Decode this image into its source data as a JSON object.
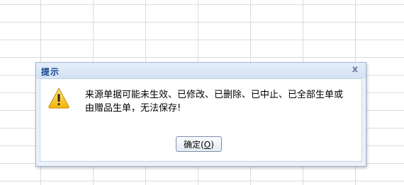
{
  "dialog": {
    "title": "提示",
    "close_glyph": "x",
    "icon": "warning-icon",
    "message": "来源单据可能未生效、已修改、已删除、已中止、已全部生单或由赠品生单，无法保存!",
    "ok_label_prefix": "确定(",
    "ok_label_key": "O",
    "ok_label_suffix": ")"
  },
  "colors": {
    "title_text": "#15428b",
    "dialog_border": "#9fb7d6",
    "warning_fill": "#f6c51a"
  }
}
